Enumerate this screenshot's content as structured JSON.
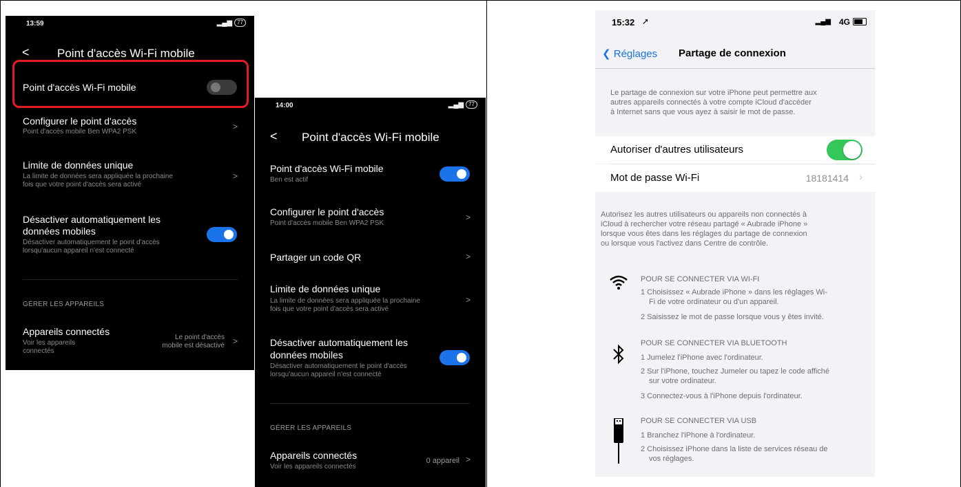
{
  "phone1": {
    "time": "13:59",
    "battery": "77",
    "title": "Point d'accès Wi-Fi mobile",
    "rows": {
      "hotspot_title": "Point d'accès Wi-Fi mobile",
      "configure_title": "Configurer le point d'accès",
      "configure_sub": "Point d'accès mobile Ben WPA2 PSK",
      "limit_title": "Limite de données unique",
      "limit_sub1": "La limite de données sera appliquée la prochaine",
      "limit_sub2": "fois que votre point d'accès sera activé",
      "auto_title1": "Désactiver automatiquement les",
      "auto_title2": "données mobiles",
      "auto_sub1": "Désactiver automatiquement le point d'accès",
      "auto_sub2": "lorsqu'aucun appareil n'est connecté",
      "section": "GÉRER LES APPAREILS",
      "devices_title": "Appareils connectés",
      "devices_sub1": "Voir les appareils",
      "devices_sub2": "connectés",
      "devices_val1": "Le point d'accès",
      "devices_val2": "mobile est désactivé"
    },
    "hotspot_on": false,
    "auto_on": true
  },
  "phone2": {
    "time": "14:00",
    "battery": "77",
    "title": "Point d'accès Wi-Fi mobile",
    "rows": {
      "hotspot_title": "Point d'accès Wi-Fi mobile",
      "hotspot_sub": "Ben est actif",
      "configure_title": "Configurer le point d'accès",
      "configure_sub": "Point d'accès mobile Ben WPA2 PSK",
      "qr_title": "Partager un code QR",
      "limit_title": "Limite de données unique",
      "limit_sub1": "La limite de données sera appliquée la prochaine",
      "limit_sub2": "fois que votre point d'accès sera activé",
      "auto_title1": "Désactiver automatiquement les",
      "auto_title2": "données mobiles",
      "auto_sub1": "Désactiver automatiquement le point d'accès",
      "auto_sub2": "lorsqu'aucun appareil n'est connecté",
      "section": "GÉRER LES APPAREILS",
      "devices_title": "Appareils connectés",
      "devices_sub": "Voir les appareils connectés",
      "devices_val": "0 appareil"
    },
    "hotspot_on": true,
    "auto_on": true
  },
  "ios": {
    "time": "15:32",
    "network": "4G",
    "back_label": "Réglages",
    "title": "Partage de connexion",
    "intro1": "Le partage de connexion sur votre iPhone peut permettre aux",
    "intro2": "autres appareils connectés à votre compte iCloud d'accéder",
    "intro3": "à Internet sans que vous ayez à saisir le mot de passe.",
    "allow_label": "Autoriser d'autres utilisateurs",
    "allow_on": true,
    "wifi_pw_label": "Mot de passe Wi-Fi",
    "wifi_pw_value": "18181414",
    "info1": "Autorisez les autres utilisateurs ou appareils non connectés à",
    "info2": "iCloud à rechercher votre réseau partagé « Aubrade iPhone »",
    "info3": "lorsque vous êtes dans les réglages du partage de connexion",
    "info4": "ou lorsque vous l'activez dans Centre de contrôle.",
    "wifi_head": "POUR SE CONNECTER VIA WI-FI",
    "wifi_s1a": "1 Choisissez « Aubrade iPhone » dans les réglages Wi-",
    "wifi_s1b": "Fi de votre ordinateur ou d'un appareil.",
    "wifi_s2": "2 Saisissez le mot de passe lorsque vous y êtes invité.",
    "bt_head": "POUR SE CONNECTER VIA BLUETOOTH",
    "bt_s1": "1 Jumelez l'iPhone avec l'ordinateur.",
    "bt_s2a": "2 Sur l'iPhone, touchez Jumeler ou tapez le code affiché",
    "bt_s2b": "sur votre ordinateur.",
    "bt_s3": "3 Connectez-vous à l'iPhone depuis l'ordinateur.",
    "usb_head": "POUR SE CONNECTER VIA USB",
    "usb_s1": "1 Branchez l'iPhone à l'ordinateur.",
    "usb_s2a": "2 Choisissez iPhone dans la liste de services réseau de",
    "usb_s2b": "vos réglages."
  },
  "colors": {
    "android_accent": "#1a73e8",
    "highlight": "#e31b23",
    "ios_green": "#34c759",
    "ios_blue": "#1a73e8"
  }
}
